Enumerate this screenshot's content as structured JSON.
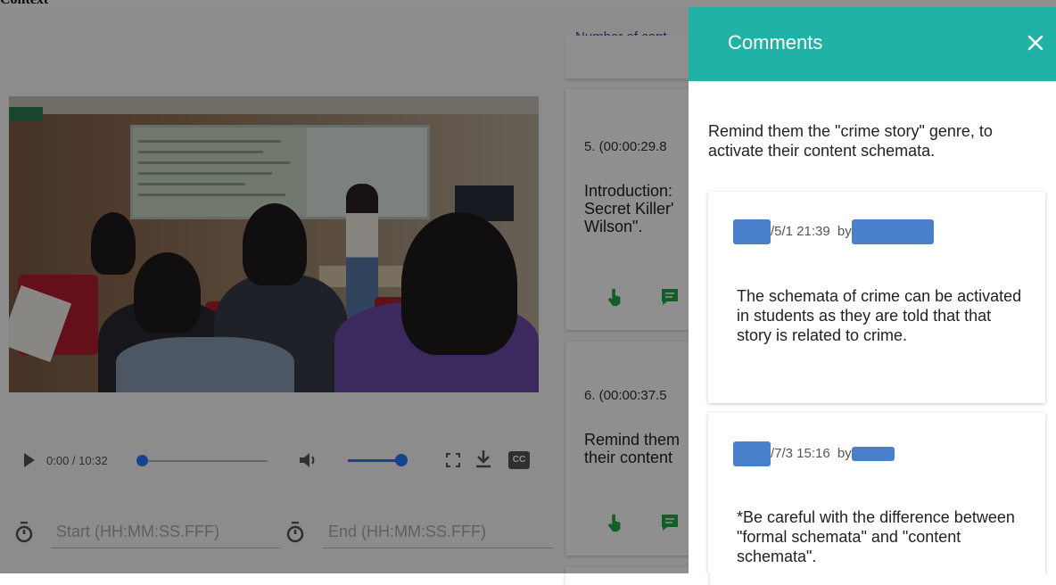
{
  "header": {
    "label": "Context"
  },
  "player": {
    "time": "0:00 / 10:32",
    "progress_fraction": 0.0,
    "volume_fraction": 0.95,
    "cc_label": "CC",
    "start_placeholder": "Start (HH:MM:SS.FFF)",
    "end_placeholder": "End (HH:MM:SS.FFF)"
  },
  "captions": {
    "count_label": "Number of capt",
    "items": [
      {
        "time": "5. (00:00:29.8",
        "text": [
          "Introduction:",
          "Secret Killer'",
          "Wilson\"."
        ]
      },
      {
        "time": "6. (00:00:37.5",
        "text": [
          "Remind them",
          "their content"
        ]
      }
    ]
  },
  "drawer": {
    "title": "Comments",
    "caption_text": "Remind them the \"crime story\" genre, to activate their content schemata.",
    "comments": [
      {
        "date": "/5/1 21:39",
        "by": "by",
        "text": "The schemata of crime can be activated in students as they are told that that story is related to crime."
      },
      {
        "date": "/7/3 15:16",
        "by": "by",
        "text": "*Be careful with the difference between \"formal schemata\" and \"content schemata\"."
      }
    ]
  },
  "colors": {
    "accent": "#20b2a6",
    "player_blue": "#2979ff",
    "icon_green": "#1fa84a",
    "redaction": "#4a7fcc"
  }
}
